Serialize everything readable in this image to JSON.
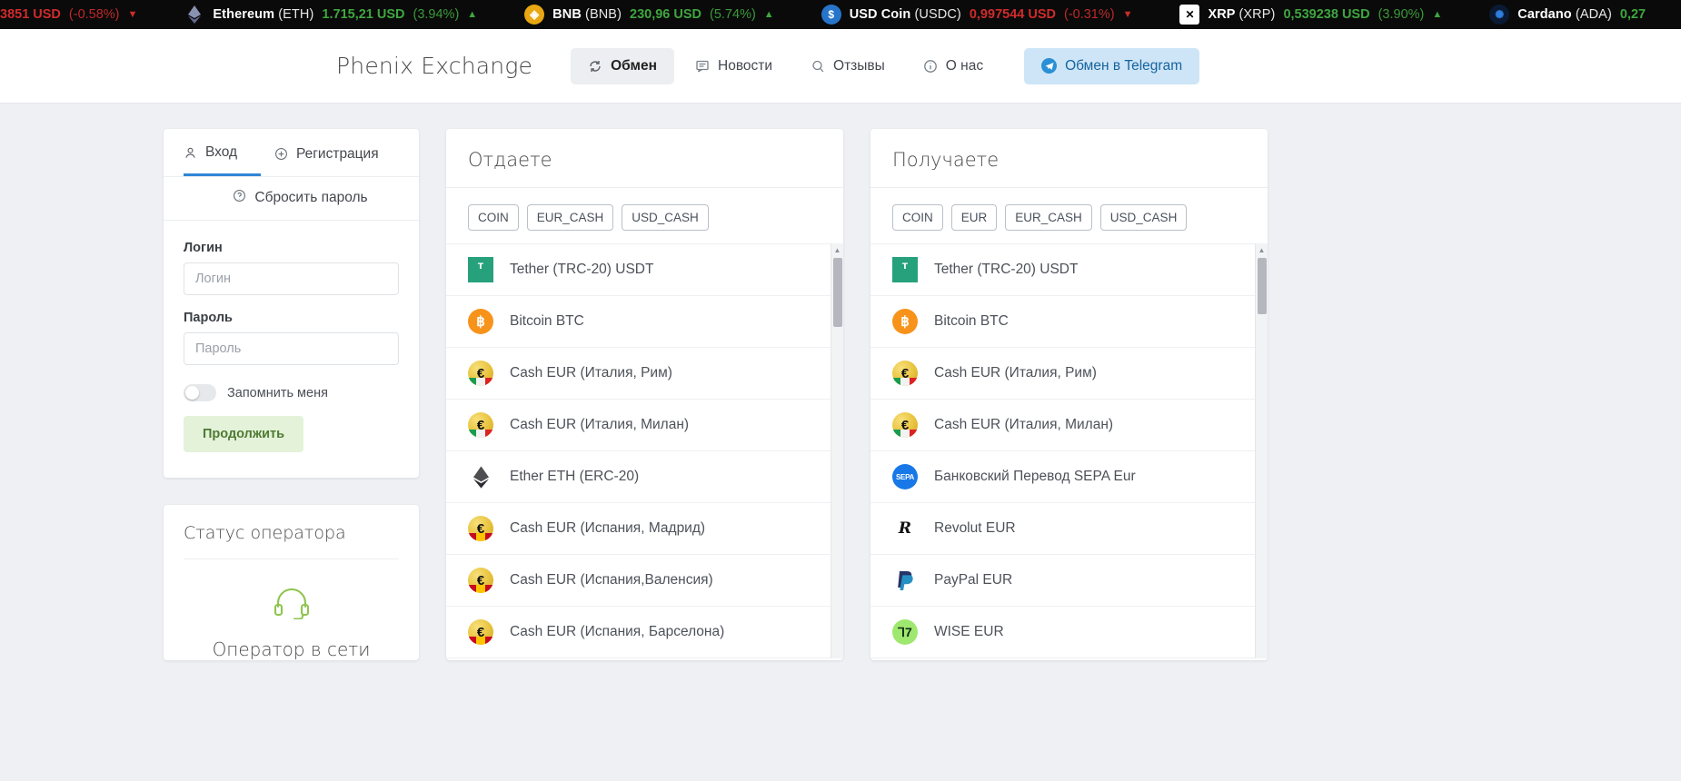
{
  "ticker": [
    {
      "icon": "generic-coin-icon",
      "name": "",
      "code": "",
      "price": "3851 USD",
      "change": "(-0.58%)",
      "dir": "down",
      "partial": true
    },
    {
      "icon": "ethereum-icon",
      "name": "Ethereum",
      "code": "(ETH)",
      "price": "1.715,21 USD",
      "change": "(3.94%)",
      "dir": "up"
    },
    {
      "icon": "bnb-icon",
      "name": "BNB",
      "code": "(BNB)",
      "price": "230,96 USD",
      "change": "(5.74%)",
      "dir": "up"
    },
    {
      "icon": "usdc-icon",
      "name": "USD Coin",
      "code": "(USDC)",
      "price": "0,997544 USD",
      "change": "(-0.31%)",
      "dir": "down"
    },
    {
      "icon": "xrp-icon",
      "name": "XRP",
      "code": "(XRP)",
      "price": "0,539238 USD",
      "change": "(3.90%)",
      "dir": "up"
    },
    {
      "icon": "cardano-icon",
      "name": "Cardano",
      "code": "(ADA)",
      "price": "0,27",
      "change": "",
      "dir": "up",
      "partial": true
    }
  ],
  "header": {
    "brand": "Phenix Exchange",
    "nav": [
      {
        "label": "Обмен",
        "icon": "exchange-icon",
        "active": true
      },
      {
        "label": "Новости",
        "icon": "news-icon",
        "active": false
      },
      {
        "label": "Отзывы",
        "icon": "reviews-icon",
        "active": false
      },
      {
        "label": "О нас",
        "icon": "info-icon",
        "active": false
      }
    ],
    "telegram": {
      "label": "Обмен в Telegram",
      "icon": "telegram-icon"
    }
  },
  "auth": {
    "tabs": [
      {
        "label": "Вход",
        "icon": "user-icon",
        "active": true
      },
      {
        "label": "Регистрация",
        "icon": "plus-circle-icon",
        "active": false
      }
    ],
    "reset": {
      "label": "Сбросить пароль",
      "icon": "question-circle-icon"
    },
    "login_label": "Логин",
    "login_placeholder": "Логин",
    "login_value": "",
    "password_label": "Пароль",
    "password_placeholder": "Пароль",
    "password_value": "",
    "remember_label": "Запомнить меня",
    "remember_on": false,
    "submit_label": "Продолжить"
  },
  "operator": {
    "title": "Статус оператора",
    "icon": "headset-icon",
    "status": "Оператор в сети"
  },
  "give": {
    "title": "Отдаете",
    "chips": [
      "COIN",
      "EUR_CASH",
      "USD_CASH"
    ],
    "items": [
      {
        "label": "Tether (TRC-20) USDT",
        "icon": "tether-icon"
      },
      {
        "label": "Bitcoin BTC",
        "icon": "bitcoin-icon"
      },
      {
        "label": "Cash EUR (Италия, Рим)",
        "icon": "euro-cash-italy-icon"
      },
      {
        "label": "Cash EUR (Италия, Милан)",
        "icon": "euro-cash-italy-icon"
      },
      {
        "label": "Ether ETH (ERC-20)",
        "icon": "ethereum-icon"
      },
      {
        "label": "Cash EUR (Испания, Мадрид)",
        "icon": "euro-cash-spain-icon"
      },
      {
        "label": "Cash EUR (Испания,Валенсия)",
        "icon": "euro-cash-spain-icon"
      },
      {
        "label": "Cash EUR (Испания, Барселона)",
        "icon": "euro-cash-spain-icon"
      }
    ]
  },
  "receive": {
    "title": "Получаете",
    "chips": [
      "COIN",
      "EUR",
      "EUR_CASH",
      "USD_CASH"
    ],
    "items": [
      {
        "label": "Tether (TRC-20) USDT",
        "icon": "tether-icon"
      },
      {
        "label": "Bitcoin BTC",
        "icon": "bitcoin-icon"
      },
      {
        "label": "Cash EUR (Италия, Рим)",
        "icon": "euro-cash-italy-icon"
      },
      {
        "label": "Cash EUR (Италия, Милан)",
        "icon": "euro-cash-italy-icon"
      },
      {
        "label": "Банковский Перевод SEPA Eur",
        "icon": "sepa-icon"
      },
      {
        "label": "Revolut EUR",
        "icon": "revolut-icon"
      },
      {
        "label": "PayPal EUR",
        "icon": "paypal-icon"
      },
      {
        "label": "WISE EUR",
        "icon": "wise-icon"
      }
    ]
  },
  "colors": {
    "accent": "#2e86d6",
    "up": "#3fa63f",
    "down": "#cf2b2b",
    "submit_bg": "#e4f2d9",
    "telegram_bg": "#cde5f7"
  }
}
